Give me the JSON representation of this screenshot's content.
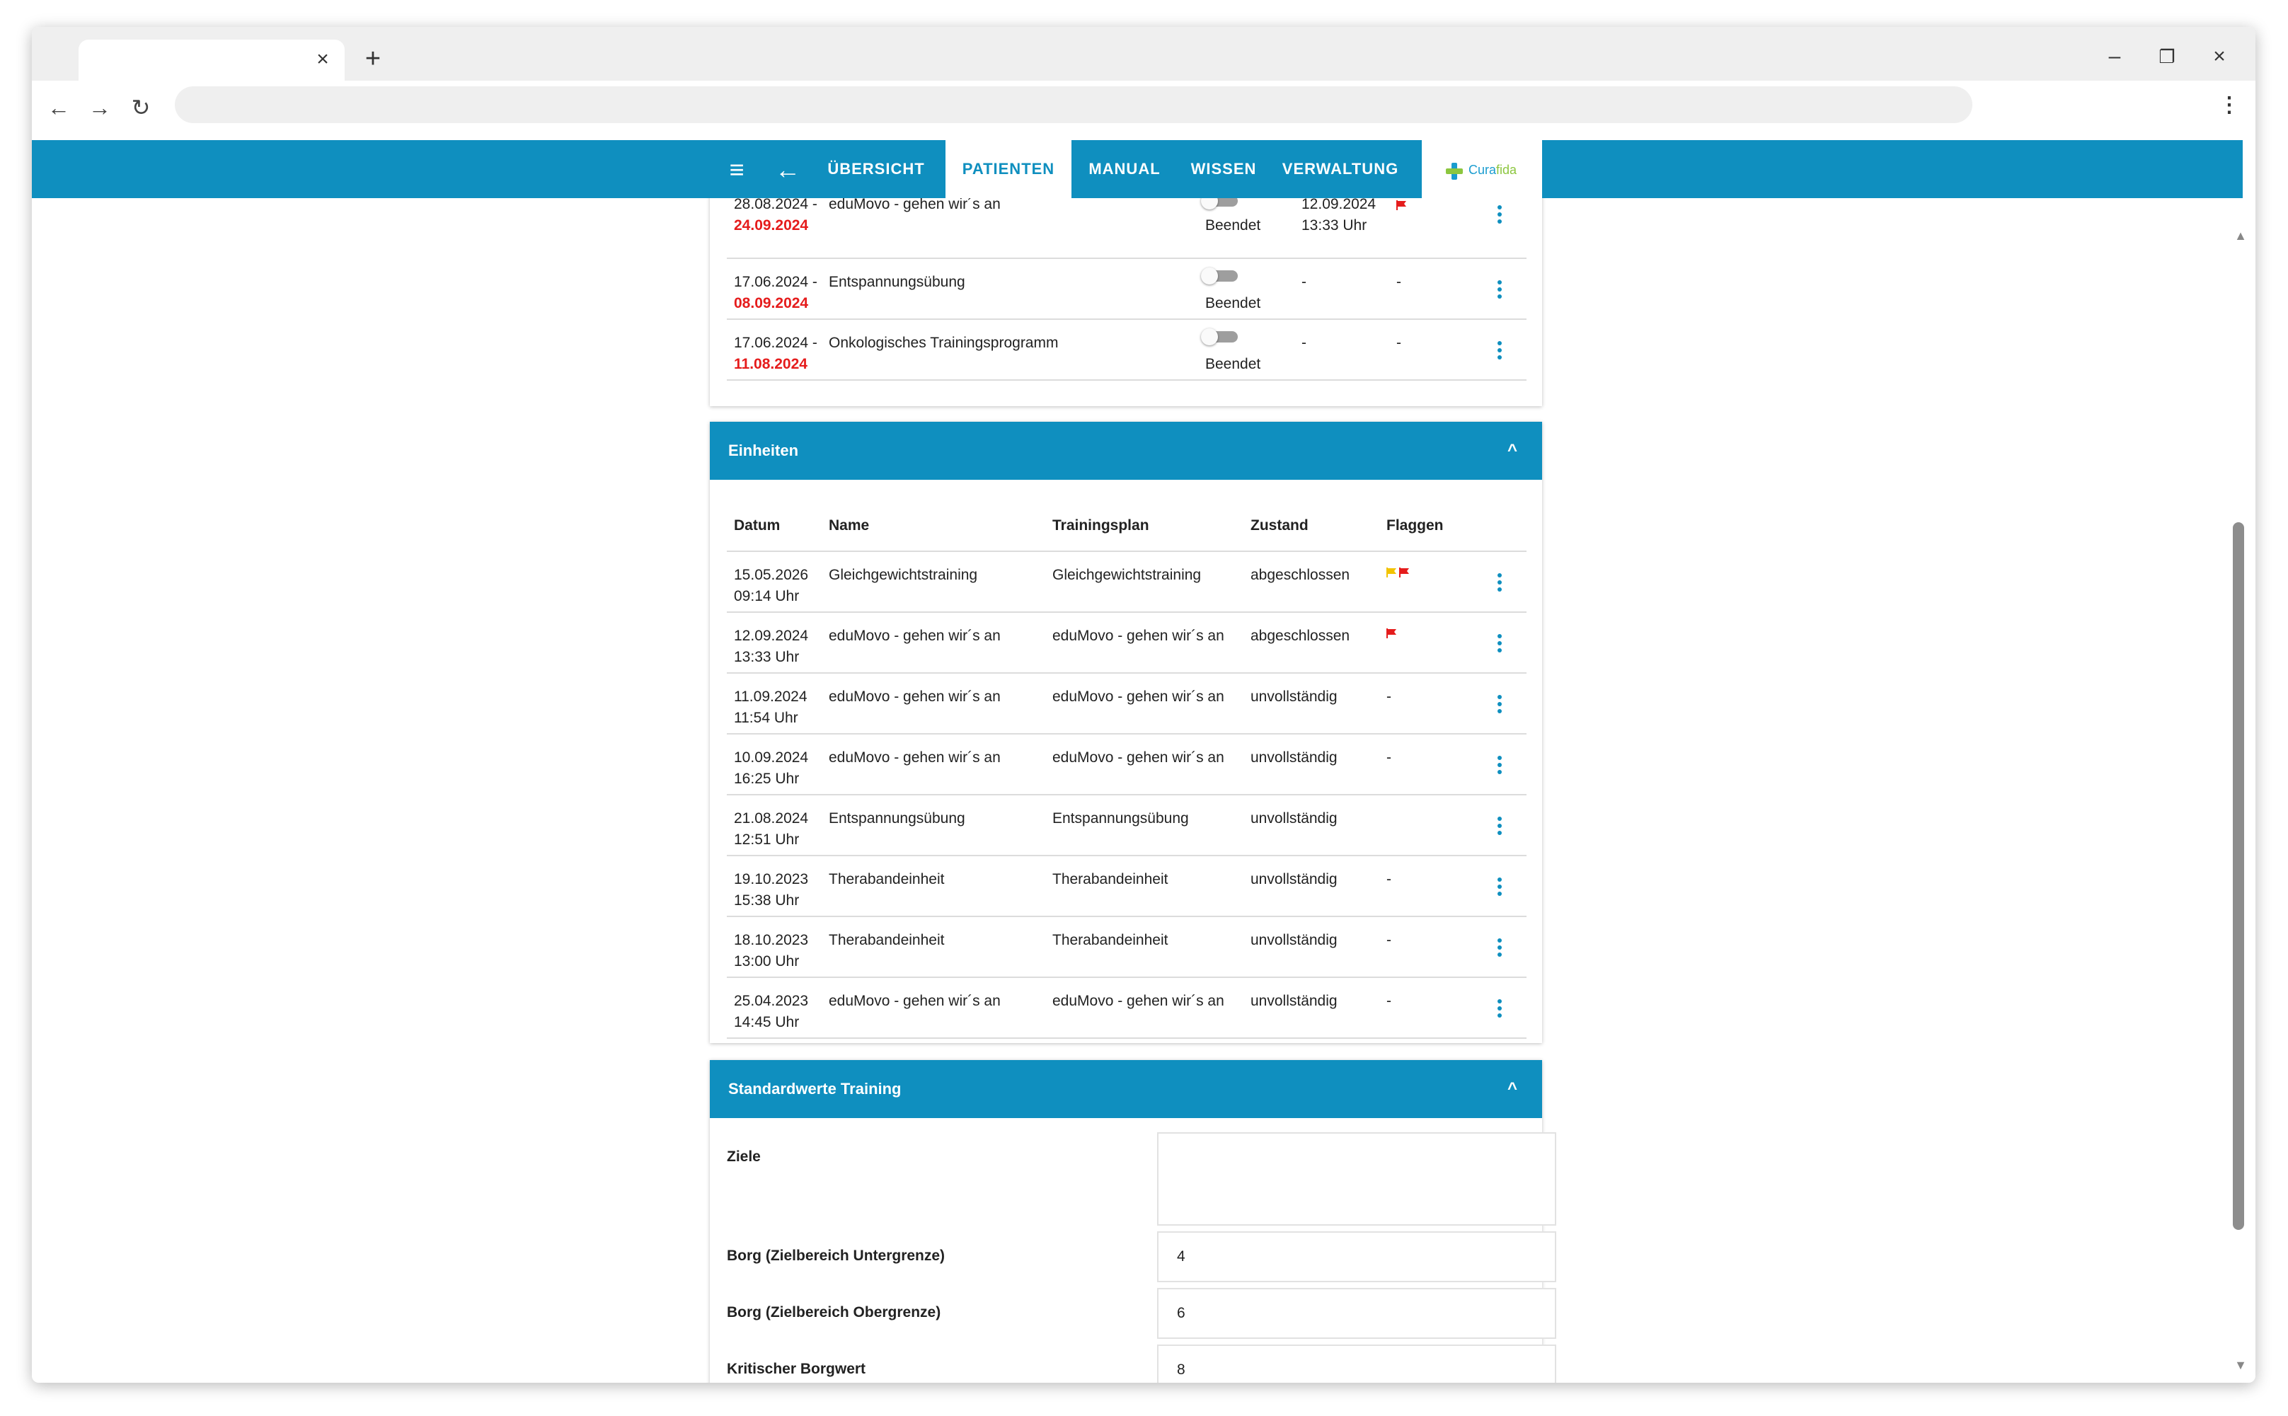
{
  "browser": {
    "tab_close": "×",
    "new_tab": "+",
    "minimize": "–",
    "restore": "❐",
    "close": "×",
    "back": "←",
    "forward": "→",
    "reload": "↻",
    "menu": "⋮"
  },
  "header": {
    "menu_icon": "≡",
    "back_icon": "←",
    "nav": [
      "ÜBERSICHT",
      "PATIENTEN",
      "MANUAL",
      "WISSEN",
      "VERWALTUNG"
    ],
    "active_nav": "PATIENTEN",
    "logo": {
      "part1": "Cura",
      "part2": "fida"
    }
  },
  "programs": {
    "rows": [
      {
        "start": "28.08.2024 -",
        "end": "24.09.2024",
        "name": "eduMovo - gehen wir´s an",
        "status": "Beendet",
        "last": "12.09.2024",
        "last_time": "13:33 Uhr",
        "flag": "red"
      },
      {
        "start": "17.06.2024 -",
        "end": "08.09.2024",
        "name": "Entspannungsübung",
        "status": "Beendet",
        "last": "-",
        "last_time": "",
        "flag_text": "-"
      },
      {
        "start": "17.06.2024 -",
        "end": "11.08.2024",
        "name": "Onkologisches Trainingsprogramm",
        "status": "Beendet",
        "last": "-",
        "last_time": "",
        "flag_text": "-"
      }
    ]
  },
  "einheiten": {
    "title": "Einheiten",
    "collapse_icon": "^",
    "columns": [
      "Datum",
      "Name",
      "Trainingsplan",
      "Zustand",
      "Flaggen"
    ],
    "rows": [
      {
        "date": "15.05.2026",
        "time": "09:14 Uhr",
        "name": "Gleichgewichtstraining",
        "plan": "Gleichgewichtstraining",
        "state": "abgeschlossen",
        "flags": [
          "yellow",
          "red"
        ],
        "flag_text": ""
      },
      {
        "date": "12.09.2024",
        "time": "13:33 Uhr",
        "name": "eduMovo - gehen wir´s an",
        "plan": "eduMovo - gehen wir´s an",
        "state": "abgeschlossen",
        "flags": [
          "red"
        ],
        "flag_text": ""
      },
      {
        "date": "11.09.2024",
        "time": "11:54 Uhr",
        "name": "eduMovo - gehen wir´s an",
        "plan": "eduMovo - gehen wir´s an",
        "state": "unvollständig",
        "flags": [],
        "flag_text": "-"
      },
      {
        "date": "10.09.2024",
        "time": "16:25 Uhr",
        "name": "eduMovo - gehen wir´s an",
        "plan": "eduMovo - gehen wir´s an",
        "state": "unvollständig",
        "flags": [],
        "flag_text": "-"
      },
      {
        "date": "21.08.2024",
        "time": "12:51 Uhr",
        "name": "Entspannungsübung",
        "plan": "Entspannungsübung",
        "state": "unvollständig",
        "flags": [],
        "flag_text": ""
      },
      {
        "date": "19.10.2023",
        "time": "15:38 Uhr",
        "name": "Therabandeinheit",
        "plan": "Therabandeinheit",
        "state": "unvollständig",
        "flags": [],
        "flag_text": "-"
      },
      {
        "date": "18.10.2023",
        "time": "13:00 Uhr",
        "name": "Therabandeinheit",
        "plan": "Therabandeinheit",
        "state": "unvollständig",
        "flags": [],
        "flag_text": "-"
      },
      {
        "date": "25.04.2023",
        "time": "14:45 Uhr",
        "name": "eduMovo - gehen wir´s an",
        "plan": "eduMovo - gehen wir´s an",
        "state": "unvollständig",
        "flags": [],
        "flag_text": "-"
      }
    ]
  },
  "standard": {
    "title": "Standardwerte Training",
    "collapse_icon": "^",
    "fields": [
      {
        "label": "Ziele",
        "value": ""
      },
      {
        "label": "Borg (Zielbereich Untergrenze)",
        "value": "4"
      },
      {
        "label": "Borg (Zielbereich Obergrenze)",
        "value": "6"
      },
      {
        "label": "Kritischer Borgwert",
        "value": "8"
      }
    ]
  },
  "colors": {
    "primary": "#0f8fbf",
    "danger": "#e51c1c",
    "flag_yellow": "#f2c300",
    "flag_red": "#e51c1c"
  },
  "scrollbar": {
    "up": "▲",
    "down": "▼"
  }
}
